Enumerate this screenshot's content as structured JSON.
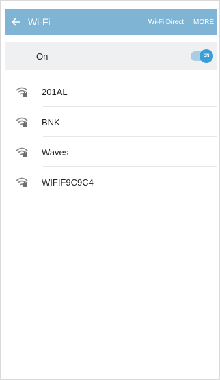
{
  "appbar": {
    "title": "Wi-Fi",
    "back_icon": "arrow-left-icon",
    "actions": {
      "wifi_direct": "Wi-Fi Direct",
      "more": "MORE"
    }
  },
  "wifi_switch": {
    "label": "On",
    "state_label": "ON"
  },
  "networks": [
    {
      "name": "201AL",
      "icon": "wifi-secured-icon"
    },
    {
      "name": "BNK",
      "icon": "wifi-secured-icon"
    },
    {
      "name": "Waves",
      "icon": "wifi-secured-icon"
    },
    {
      "name": "WIFIF9C9C4",
      "icon": "wifi-secured-icon"
    }
  ],
  "colors": {
    "appbar": "#7fb4d5",
    "toggle_on": "#3a9fd9",
    "onbar_bg": "#eef0f1"
  }
}
